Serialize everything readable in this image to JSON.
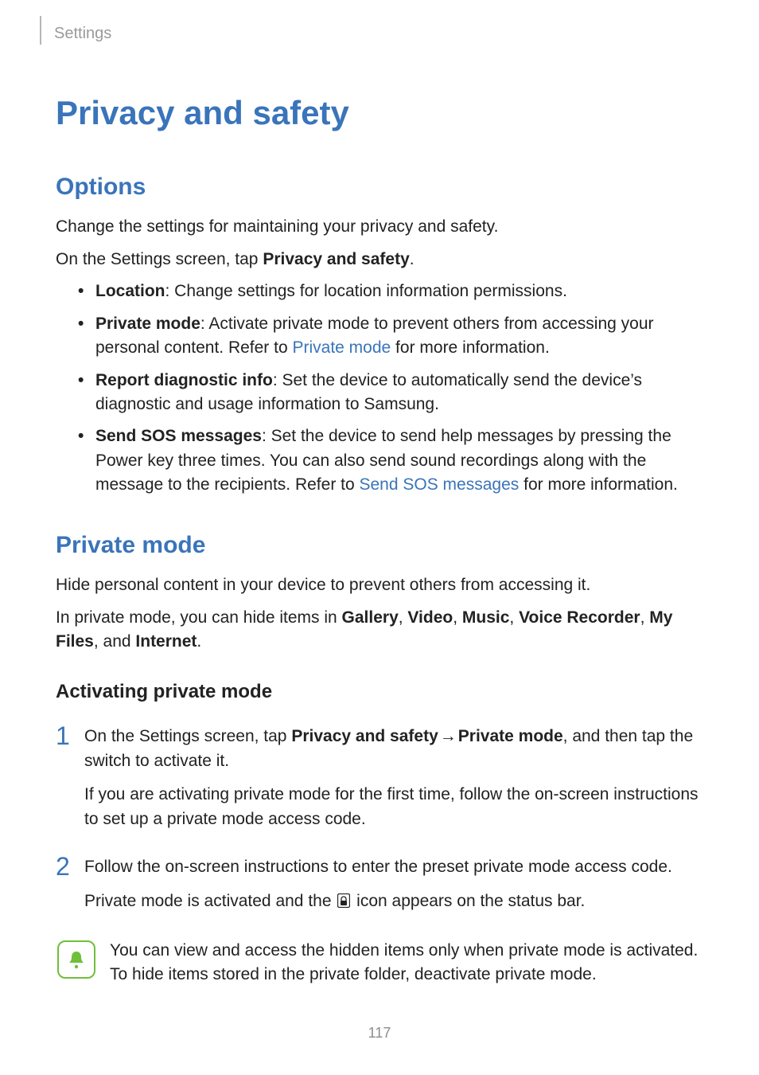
{
  "breadcrumb": "Settings",
  "page_title": "Privacy and safety",
  "options": {
    "heading": "Options",
    "intro1": "Change the settings for maintaining your privacy and safety.",
    "intro2_prefix": "On the Settings screen, tap ",
    "intro2_bold": "Privacy and safety",
    "intro2_suffix": ".",
    "bullets": {
      "location": {
        "label": "Location",
        "text": ": Change settings for location information permissions."
      },
      "private_mode": {
        "label": "Private mode",
        "text_before_link": ": Activate private mode to prevent others from accessing your personal content. Refer to ",
        "link": "Private mode",
        "text_after_link": " for more information."
      },
      "report": {
        "label": "Report diagnostic info",
        "text": ": Set the device to automatically send the device’s diagnostic and usage information to Samsung."
      },
      "sos": {
        "label": "Send SOS messages",
        "text_before_link": ": Set the device to send help messages by pressing the Power key three times. You can also send sound recordings along with the message to the recipients. Refer to ",
        "link": "Send SOS messages",
        "text_after_link": " for more information."
      }
    }
  },
  "private_mode": {
    "heading": "Private mode",
    "intro1": "Hide personal content in your device to prevent others from accessing it.",
    "intro2_parts": {
      "p1": "In private mode, you can hide items in ",
      "b1": "Gallery",
      "c1": ", ",
      "b2": "Video",
      "c2": ", ",
      "b3": "Music",
      "c3": ", ",
      "b4": "Voice Recorder",
      "c4": ", ",
      "b5": "My Files",
      "c5": ", and ",
      "b6": "Internet",
      "c6": "."
    },
    "sub_heading": "Activating private mode",
    "steps": {
      "one": {
        "num": "1",
        "l1_p1": "On the Settings screen, tap ",
        "l1_b1": "Privacy and safety",
        "l1_arrow": " → ",
        "l1_b2": "Private mode",
        "l1_p2": ", and then tap the switch to activate it.",
        "l2": "If you are activating private mode for the first time, follow the on-screen instructions to set up a private mode access code."
      },
      "two": {
        "num": "2",
        "l1": "Follow the on-screen instructions to enter the preset private mode access code.",
        "l2_p1": "Private mode is activated and the ",
        "l2_p2": " icon appears on the status bar."
      }
    },
    "note": "You can view and access the hidden items only when private mode is activated. To hide items stored in the private folder, deactivate private mode."
  },
  "page_number": "117"
}
